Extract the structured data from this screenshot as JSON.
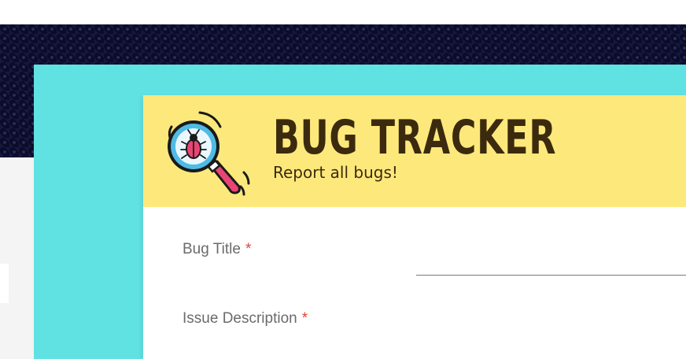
{
  "header": {
    "title": "BUG TRACKER",
    "subtitle": "Report all bugs!",
    "logo_icon": "magnifier-bug-icon"
  },
  "form": {
    "fields": [
      {
        "label": "Bug Title",
        "required_marker": "*",
        "value": ""
      },
      {
        "label": "Issue Description",
        "required_marker": "*",
        "value": ""
      }
    ]
  },
  "colors": {
    "page_background": "#0c0c2a",
    "teal_card": "#61e2e2",
    "header_background": "#fde97b",
    "title_text": "#3c2a0e",
    "label_text": "#6b6b6b",
    "required_marker": "#e0443a"
  }
}
